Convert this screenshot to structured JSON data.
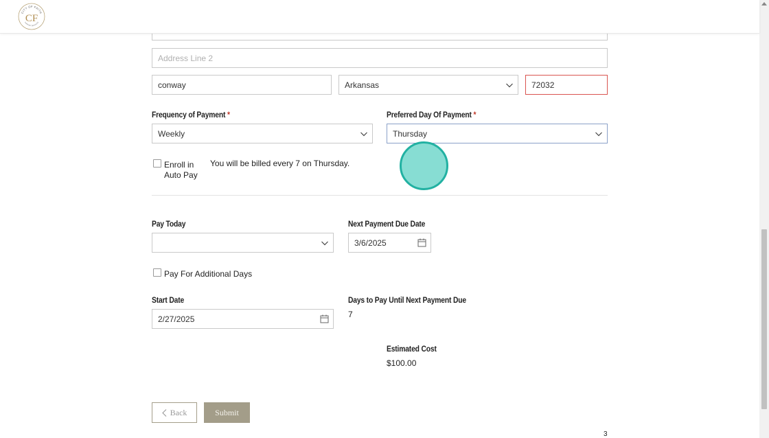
{
  "header": {
    "logo_top_text": "CITY OF FAITH",
    "logo_monogram": "CF",
    "logo_bottom_text": "SUPPORT SERVICES"
  },
  "address": {
    "line2_placeholder": "Address Line 2",
    "city": "conway",
    "state": "Arkansas",
    "zip": "72032"
  },
  "payment_frequency": {
    "label": "Frequency of Payment",
    "required_mark": "*",
    "value": "Weekly"
  },
  "preferred_day": {
    "label": "Preferred Day Of Payment",
    "required_mark": "*",
    "value": "Thursday"
  },
  "autopay": {
    "label_line1": "Enroll in",
    "label_line2": "Auto Pay",
    "checked": false,
    "billing_note": "You will be billed every 7 on Thursday."
  },
  "pay_today": {
    "label": "Pay Today",
    "value": ""
  },
  "next_payment": {
    "label": "Next Payment Due Date",
    "value": "3/6/2025"
  },
  "additional_days": {
    "label": "Pay For Additional Days",
    "checked": false
  },
  "start_date": {
    "label": "Start Date",
    "value": "2/27/2025"
  },
  "days_to_pay": {
    "label": "Days to Pay Until Next Payment Due",
    "value": "7"
  },
  "estimated_cost": {
    "label": "Estimated Cost",
    "value": "$100.00"
  },
  "buttons": {
    "back_label": "Back",
    "submit_label": "Submit"
  },
  "page_number": "3",
  "colors": {
    "accent": "#a39d89",
    "required": "#c0392b",
    "error_border": "#d9534f",
    "cursor_fill": "#5fd2c4",
    "cursor_ring": "#22b1a2"
  }
}
